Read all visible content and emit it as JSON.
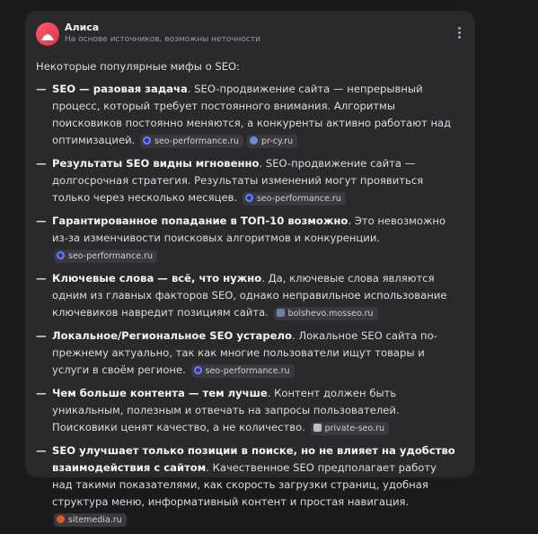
{
  "header": {
    "name": "Алиса",
    "subtitle": "На основе источников, возможны неточности"
  },
  "intro": "Некоторые популярные мифы о SEO:",
  "items": [
    {
      "bold": "SEO — разовая задача",
      "text": ". SEO-продвижение сайта — непрерывный процесс, который требует постоянного внимания. Алгоритмы поисковиков постоянно меняются, а конкуренты активно работают над оптимизацией.",
      "sources": [
        {
          "label": "seo-performance.ru",
          "icon": "seo"
        },
        {
          "label": "pr-cy.ru",
          "icon": "prcy"
        }
      ]
    },
    {
      "bold": "Результаты SEO видны мгновенно",
      "text": ". SEO-продвижение сайта — долгосрочная стратегия. Результаты изменений могут проявиться только через несколько месяцев.",
      "sources": [
        {
          "label": "seo-performance.ru",
          "icon": "seo"
        }
      ]
    },
    {
      "bold": "Гарантированное попадание в ТОП-10 возможно",
      "text": ". Это невозможно из-за изменчивости поисковых алгоритмов и конкуренции.",
      "sources": [
        {
          "label": "seo-performance.ru",
          "icon": "seo"
        }
      ]
    },
    {
      "bold": "Ключевые слова — всё, что нужно",
      "text": ". Да, ключевые слова являются одним из главных факторов SEO, однако неправильное использование ключевиков навредит позициям сайта.",
      "sources": [
        {
          "label": "bolshevo.mosseo.ru",
          "icon": "bols"
        }
      ]
    },
    {
      "bold": "Локальное/Региональное SEO устарело",
      "text": ". Локальное SEO сайта по-прежнему актуально, так как многие пользователи ищут товары и услуги в своём регионе.",
      "sources": [
        {
          "label": "seo-performance.ru",
          "icon": "seo"
        }
      ]
    },
    {
      "bold": "Чем больше контента — тем лучше",
      "text": ". Контент должен быть уникальным, полезным и отвечать на запросы пользователей. Поисковики ценят качество, а не количество.",
      "sources": [
        {
          "label": "private-seo.ru",
          "icon": "priv"
        }
      ]
    },
    {
      "bold": "SEO улучшает только позиции в поиске, но не влияет на удобство взаимодействия с сайтом",
      "text": ". Качественное SEO предполагает работу над такими показателями, как скорость загрузки страниц, удобная структура меню, информативный контент и простая навигация.",
      "sources": [
        {
          "label": "sitemedia.ru",
          "icon": "site"
        }
      ]
    }
  ],
  "colors": {
    "background": "#1b1b1d",
    "card": "#2a2a2d",
    "avatar": "#e0334a",
    "chip": "#3a3a3e"
  },
  "icons": {
    "avatar": "alice-logo-icon",
    "menu": "more-vertical-icon"
  }
}
